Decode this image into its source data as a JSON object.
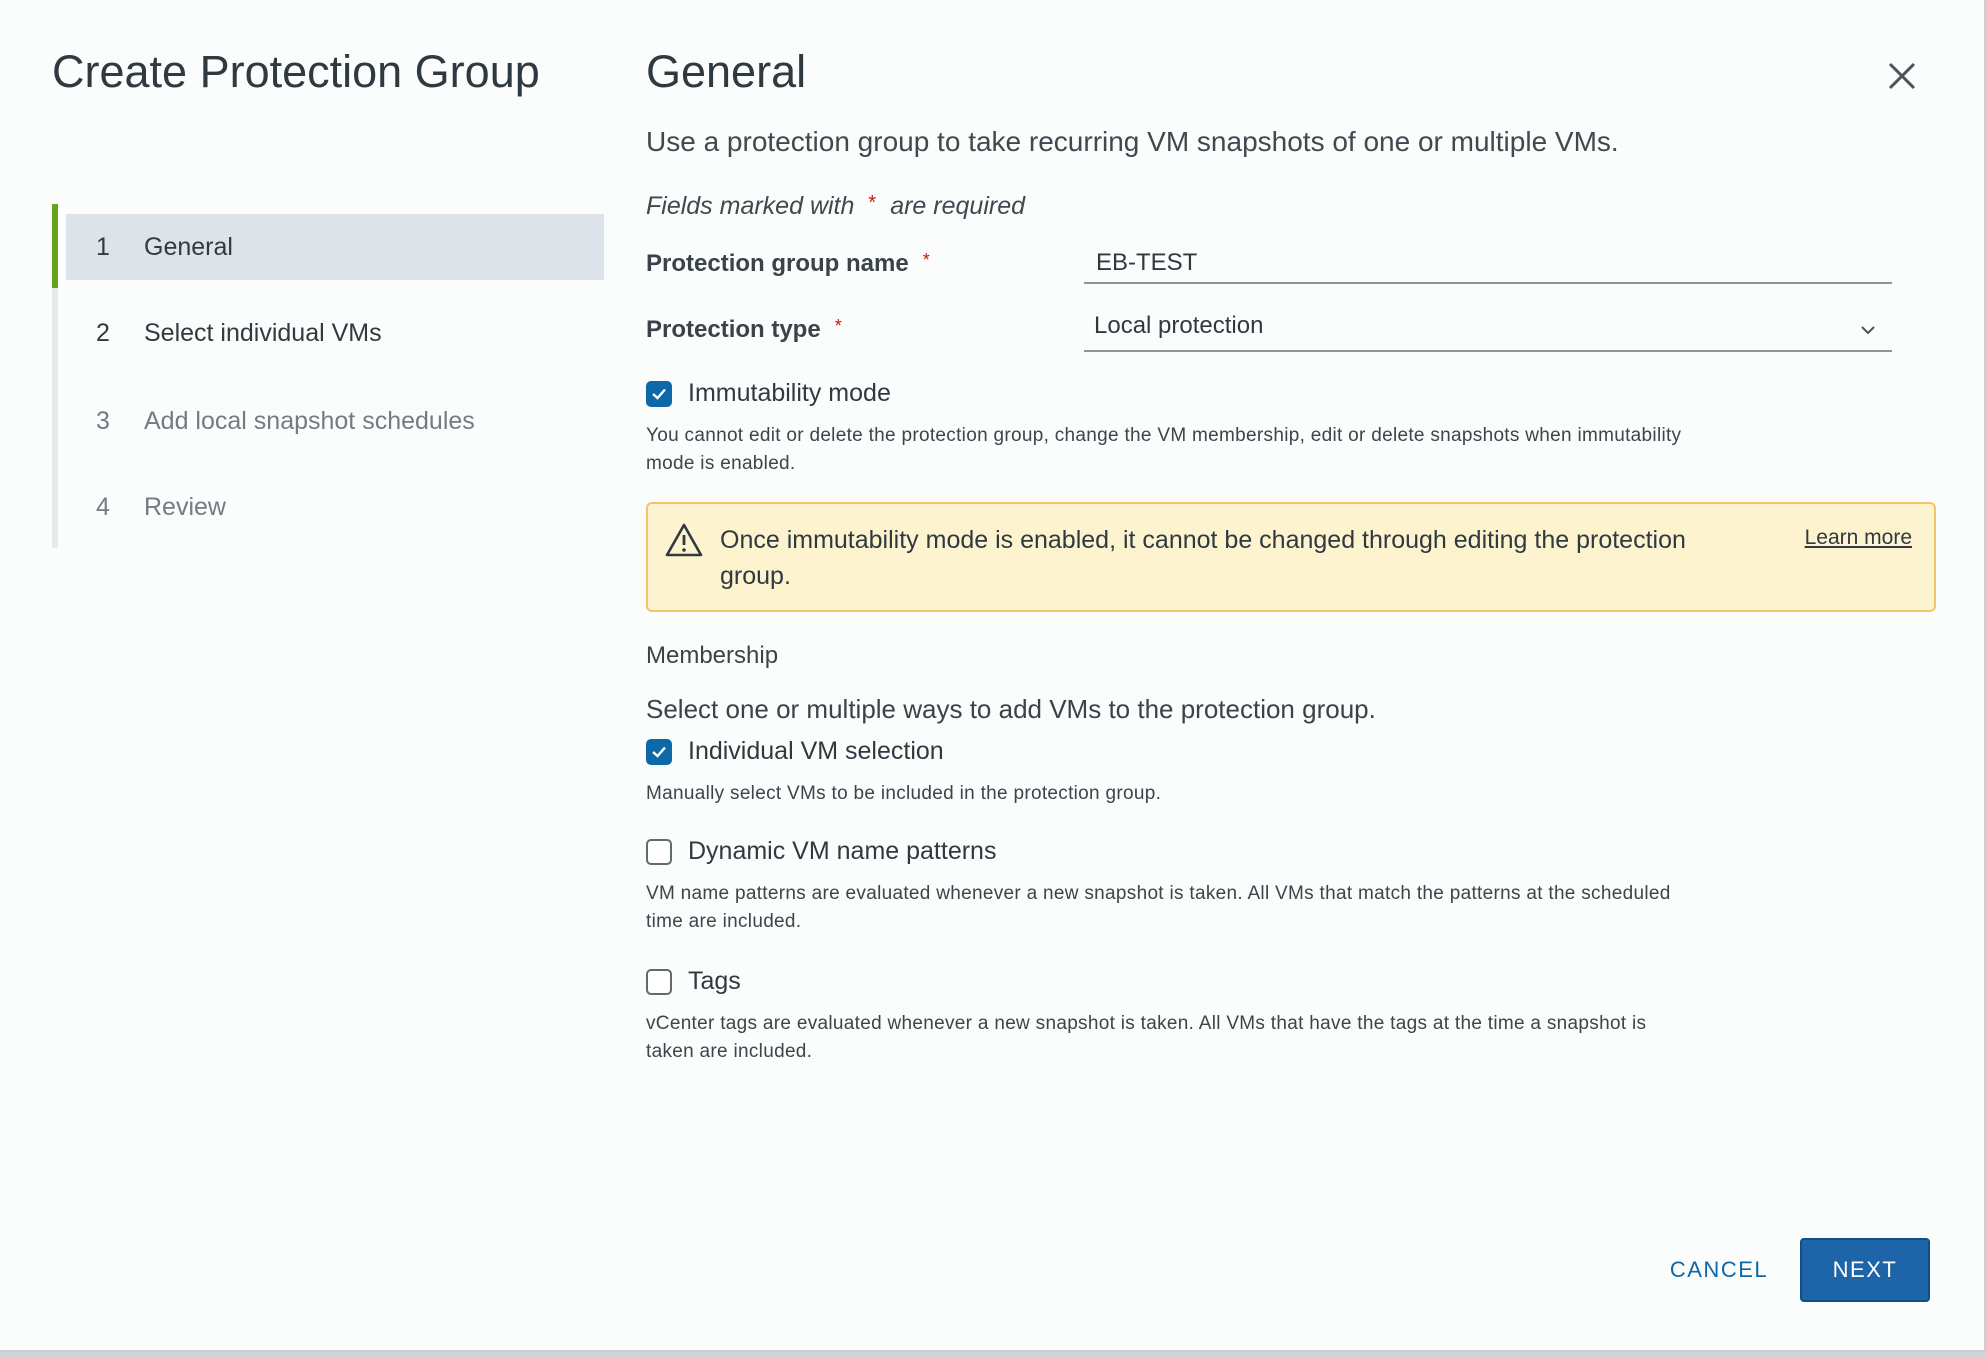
{
  "wizard": {
    "title": "Create Protection Group",
    "steps": [
      {
        "num": "1",
        "label": "General"
      },
      {
        "num": "2",
        "label": "Select individual VMs"
      },
      {
        "num": "3",
        "label": "Add local snapshot schedules"
      },
      {
        "num": "4",
        "label": "Review"
      }
    ]
  },
  "page": {
    "title": "General",
    "description": "Use a protection group to take recurring VM snapshots of one or multiple VMs.",
    "required_prefix": "Fields marked with",
    "required_star": "*",
    "required_suffix": "are required"
  },
  "form": {
    "name_label": "Protection group name",
    "name_value": "EB-TEST",
    "type_label": "Protection type",
    "type_value": "Local protection",
    "required_star": "*"
  },
  "immutability": {
    "label": "Immutability mode",
    "checked": true,
    "help": "You cannot edit or delete the protection group, change the VM membership, edit or delete snapshots when immutability mode is enabled."
  },
  "alert": {
    "message": "Once immutability mode is enabled, it cannot be changed through editing the protection group.",
    "link": "Learn more",
    "icon": "warning-icon"
  },
  "membership": {
    "heading": "Membership",
    "description": "Select one or multiple ways to add VMs to the protection group.",
    "options": [
      {
        "label": "Individual VM selection",
        "checked": true,
        "help": "Manually select VMs to be included in the protection group."
      },
      {
        "label": "Dynamic VM name patterns",
        "checked": false,
        "help": "VM name patterns are evaluated whenever a new snapshot is taken. All VMs that match the patterns at the scheduled time are included."
      },
      {
        "label": "Tags",
        "checked": false,
        "help": "vCenter tags are evaluated whenever a new snapshot is taken. All VMs that have the tags at the time a snapshot is taken are included."
      }
    ]
  },
  "footer": {
    "cancel": "CANCEL",
    "next": "NEXT"
  },
  "colors": {
    "accent_green": "#62a420",
    "primary_blue": "#1d65a8",
    "warning_bg": "#fdf3cf",
    "warning_border": "#f2c566",
    "required_red": "#c21d00"
  }
}
